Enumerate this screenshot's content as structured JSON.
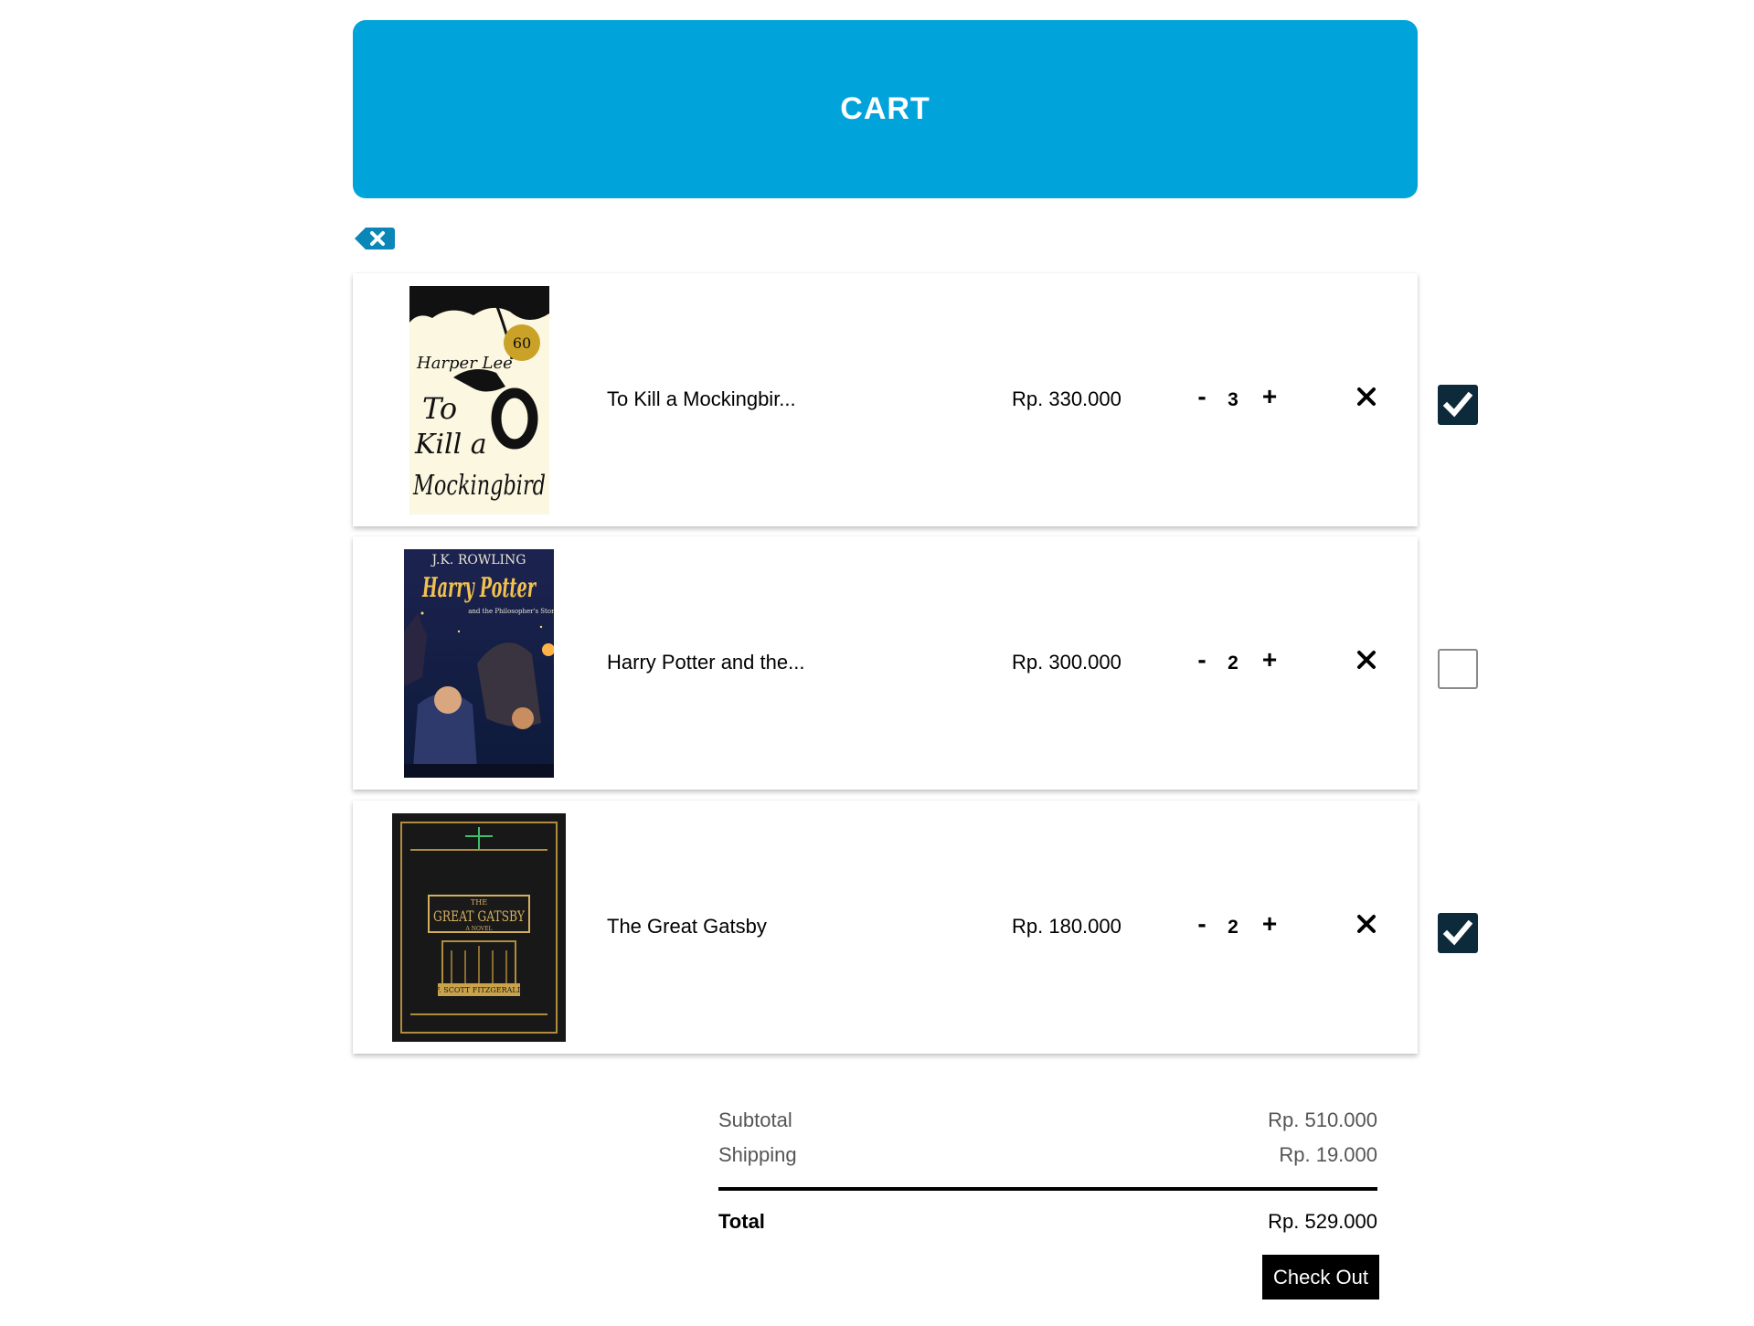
{
  "header": {
    "title": "CART"
  },
  "clear_button": {
    "icon": "backspace-x-icon",
    "color": "#0a86b8"
  },
  "items": [
    {
      "cover": {
        "author": "Harper Lee",
        "title_lines": [
          "To",
          "Kill a",
          "Mockingbird"
        ],
        "badge": "60"
      },
      "title": "To Kill a Mockingbir...",
      "price": "Rp. 330.000",
      "minus": "-",
      "qty": "3",
      "plus": "+",
      "checked": true
    },
    {
      "cover": {
        "author": "J.K. ROWLING",
        "title": "Harry Potter",
        "subtitle": "and the Philosopher's Stone"
      },
      "title": "Harry Potter and the...",
      "price": "Rp. 300.000",
      "minus": "-",
      "qty": "2",
      "plus": "+",
      "checked": false
    },
    {
      "cover": {
        "top": "THE",
        "title": "GREAT GATSBY",
        "sub": "A NOVEL",
        "author": "F. SCOTT FITZGERALD"
      },
      "title": "The Great Gatsby",
      "price": "Rp. 180.000",
      "minus": "-",
      "qty": "2",
      "plus": "+",
      "checked": true
    }
  ],
  "summary": {
    "subtotal_label": "Subtotal",
    "subtotal_value": "Rp. 510.000",
    "shipping_label": "Shipping",
    "shipping_value": "Rp. 19.000",
    "total_label": "Total",
    "total_value": "Rp. 529.000"
  },
  "checkout_label": "Check Out",
  "colors": {
    "header_bg": "#00a4db",
    "checkbox_on": "#0d2a3b",
    "checkout_bg": "#000000"
  }
}
